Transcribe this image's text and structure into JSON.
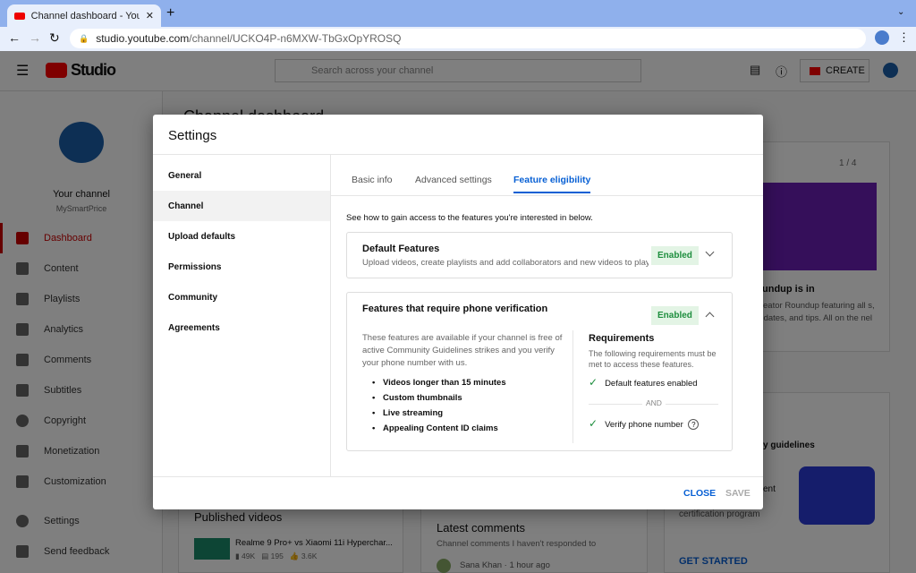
{
  "browser": {
    "tab_title": "Channel dashboard - YouTube",
    "url_host": "studio.youtube.com",
    "url_path": "/channel/UCKO4P-n6MXW-TbGxOpYROSQ"
  },
  "header": {
    "logo": "Studio",
    "search_placeholder": "Search across your channel",
    "create_label": "CREATE"
  },
  "sidebar": {
    "channel_label": "Your channel",
    "channel_name": "MySmartPrice",
    "items": [
      {
        "label": "Dashboard",
        "active": true
      },
      {
        "label": "Content"
      },
      {
        "label": "Playlists"
      },
      {
        "label": "Analytics"
      },
      {
        "label": "Comments"
      },
      {
        "label": "Subtitles"
      },
      {
        "label": "Copyright"
      },
      {
        "label": "Monetization"
      },
      {
        "label": "Customization"
      },
      {
        "label": "Settings"
      },
      {
        "label": "Send feedback"
      }
    ]
  },
  "background": {
    "page_title": "Channel dashboard",
    "news_pager": "1 / 4",
    "news_title": "undup is in",
    "news_body": "Creator Roundup featuring all s, updates, and tips. All on the nel",
    "guidelines_title": "y guidelines",
    "cert_text": "ent",
    "cert_text2": "certification program",
    "get_started": "GET STARTED",
    "published_title": "Published videos",
    "video_title": "Realme 9 Pro+ vs Xiaomi 11i Hyperchar...",
    "video_views": "49K",
    "video_comments": "195",
    "video_likes": "3.6K",
    "comments_title": "Latest comments",
    "comments_sub": "Channel comments I haven't responded to",
    "comment_author": "Sana Khan",
    "comment_time": "· 1 hour ago"
  },
  "modal": {
    "title": "Settings",
    "nav": [
      {
        "label": "General"
      },
      {
        "label": "Channel",
        "selected": true
      },
      {
        "label": "Upload defaults"
      },
      {
        "label": "Permissions"
      },
      {
        "label": "Community"
      },
      {
        "label": "Agreements"
      }
    ],
    "tabs": [
      {
        "label": "Basic info"
      },
      {
        "label": "Advanced settings"
      },
      {
        "label": "Feature eligibility",
        "active": true
      }
    ],
    "intro": "See how to gain access to the features you're interested in below.",
    "default_card": {
      "title": "Default Features",
      "desc": "Upload videos, create playlists and add collaborators and new videos to play...",
      "status": "Enabled"
    },
    "phone_card": {
      "title": "Features that require phone verification",
      "status": "Enabled",
      "desc": "These features are available if your channel is free of active Community Guidelines strikes and you verify your phone number with us.",
      "features": [
        "Videos longer than 15 minutes",
        "Custom thumbnails",
        "Live streaming",
        "Appealing Content ID claims"
      ],
      "req_title": "Requirements",
      "req_desc": "The following requirements must be met to access these features.",
      "req1": "Default features enabled",
      "and": "AND",
      "req2": "Verify phone number"
    },
    "close_label": "CLOSE",
    "save_label": "SAVE"
  },
  "colors": {
    "accent": "#065fd4",
    "enabled_bg": "#e3f4e5",
    "enabled_text": "#1e8e3e",
    "brand": "#ff0000"
  }
}
